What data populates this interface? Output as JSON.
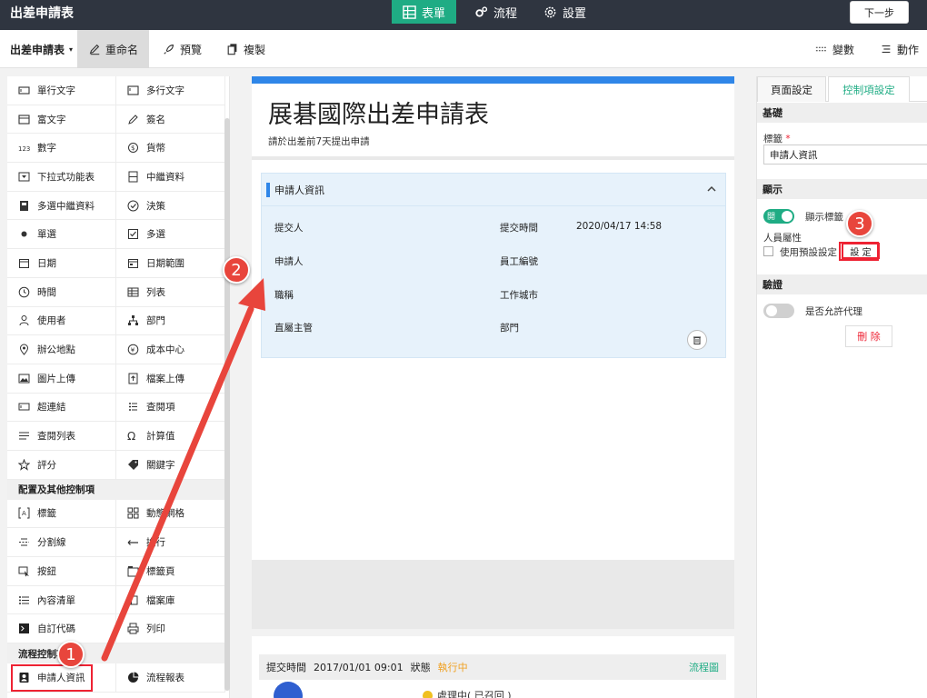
{
  "app": {
    "title": "出差申請表",
    "tabs": [
      {
        "label": "表單",
        "active": true
      },
      {
        "label": "流程",
        "active": false
      },
      {
        "label": "設置",
        "active": false
      }
    ],
    "next_label": "下一步"
  },
  "toolbar": {
    "form_name": "出差申請表",
    "rename": "重命名",
    "preview": "預覽",
    "copy": "複製",
    "variables": "變數",
    "actions": "動作"
  },
  "palette": {
    "basic": [
      {
        "label": "單行文字",
        "icon": "single-line-icon"
      },
      {
        "label": "多行文字",
        "icon": "multi-line-icon"
      },
      {
        "label": "富文字",
        "icon": "rich-text-icon"
      },
      {
        "label": "簽名",
        "icon": "signature-icon"
      },
      {
        "label": "數字",
        "icon": "number-icon"
      },
      {
        "label": "貨幣",
        "icon": "currency-icon"
      },
      {
        "label": "下拉式功能表",
        "icon": "dropdown-icon"
      },
      {
        "label": "中繼資料",
        "icon": "metadata-icon"
      },
      {
        "label": "多選中繼資料",
        "icon": "multi-metadata-icon"
      },
      {
        "label": "決策",
        "icon": "decision-icon"
      },
      {
        "label": "單選",
        "icon": "radio-icon"
      },
      {
        "label": "多選",
        "icon": "checkbox-icon"
      },
      {
        "label": "日期",
        "icon": "date-icon"
      },
      {
        "label": "日期範圍",
        "icon": "date-range-icon"
      },
      {
        "label": "時間",
        "icon": "clock-icon"
      },
      {
        "label": "列表",
        "icon": "table-icon"
      },
      {
        "label": "使用者",
        "icon": "user-icon"
      },
      {
        "label": "部門",
        "icon": "department-icon"
      },
      {
        "label": "辦公地點",
        "icon": "location-icon"
      },
      {
        "label": "成本中心",
        "icon": "cost-center-icon"
      },
      {
        "label": "圖片上傳",
        "icon": "image-upload-icon"
      },
      {
        "label": "檔案上傳",
        "icon": "file-upload-icon"
      },
      {
        "label": "超連結",
        "icon": "hyperlink-icon"
      },
      {
        "label": "查閱項",
        "icon": "lookup-icon"
      },
      {
        "label": "查閱列表",
        "icon": "lookup-list-icon"
      },
      {
        "label": "計算值",
        "icon": "omega-icon"
      },
      {
        "label": "評分",
        "icon": "star-icon"
      },
      {
        "label": "關鍵字",
        "icon": "tag-icon"
      }
    ],
    "layout_section": "配置及其他控制項",
    "layout": [
      {
        "label": "標籤",
        "icon": "label-icon"
      },
      {
        "label": "動態網格",
        "icon": "grid-icon"
      },
      {
        "label": "分割線",
        "icon": "divider-icon"
      },
      {
        "label": "換行",
        "icon": "line-break-icon"
      },
      {
        "label": "按鈕",
        "icon": "button-icon"
      },
      {
        "label": "標籤頁",
        "icon": "tab-page-icon"
      },
      {
        "label": "內容清單",
        "icon": "content-list-icon"
      },
      {
        "label": "檔案庫",
        "icon": "library-icon"
      },
      {
        "label": "自訂代碼",
        "icon": "code-icon"
      },
      {
        "label": "列印",
        "icon": "print-icon"
      }
    ],
    "flow_section": "流程控制項",
    "flow": [
      {
        "label": "申請人資訊",
        "icon": "applicant-icon"
      },
      {
        "label": "流程報表",
        "icon": "pie-chart-icon"
      }
    ]
  },
  "canvas": {
    "title": "展碁國際出差申請表",
    "subtitle": "請於出差前7天提出申請",
    "section_title": "申請人資訊",
    "fields": {
      "submit_time_label": "提交人",
      "submit_time_col": "提交時間",
      "submit_time_value": "2020/04/17 14:58",
      "applicant": "申請人",
      "employee_id": "員工編號",
      "title": "職稱",
      "work_city": "工作城市",
      "supervisor": "直屬主管",
      "department": "部門"
    },
    "status": {
      "label": "提交時間",
      "time": "2017/01/01 09:01",
      "state_label": "狀態",
      "state": "執行中",
      "flow_link": "流程圖",
      "processing": "處理中( 已召回 )"
    }
  },
  "props": {
    "tabs": [
      {
        "label": "頁面設定",
        "active": false
      },
      {
        "label": "控制項設定",
        "active": true
      }
    ],
    "basic_section": "基礎",
    "label_field": "標籤",
    "label_value": "申請人資訊",
    "display_section": "顯示",
    "toggle_on_text": "開",
    "show_label": "顯示標籤",
    "user_attr": "人員屬性",
    "use_default": "使用預設設定",
    "set_button": "設 定",
    "validation_section": "驗證",
    "allow_proxy": "是否允許代理",
    "delete_button": "刪 除"
  },
  "annotations": {
    "marker1": "1",
    "marker2": "2",
    "marker3": "3",
    "accent_color": "#e8453c"
  },
  "colors": {
    "topbar": "#2f3540",
    "accent": "#1fac84",
    "blue": "#2f86e8"
  }
}
